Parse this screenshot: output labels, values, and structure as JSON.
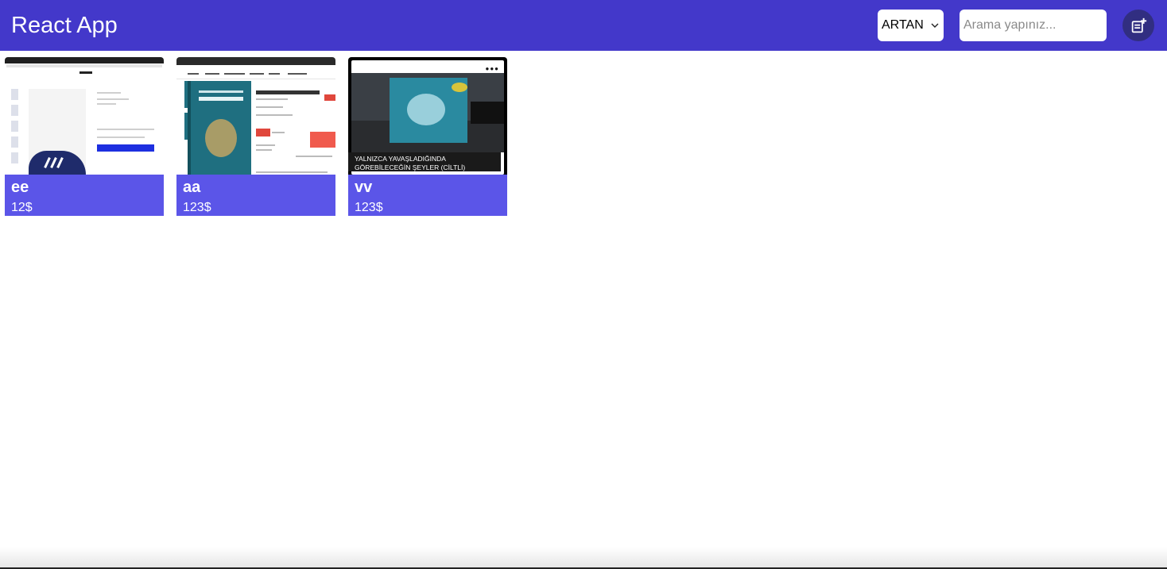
{
  "navbar": {
    "brand": "React App",
    "sort": {
      "selected": "ARTAN"
    },
    "search": {
      "placeholder": "Arama yapınız..."
    },
    "add_icon": "note-add-icon",
    "bg_color": "#4338ca"
  },
  "products": [
    {
      "title": "ee",
      "price": "12$",
      "thumb": "shoe-shop-screenshot"
    },
    {
      "title": "aa",
      "price": "123$",
      "thumb": "book-shop-screenshot"
    },
    {
      "title": "vv",
      "price": "123$",
      "thumb": "book-photo",
      "caption": "YALNIZCA YAVAŞLADIĞINDA GÖREBİLECEĞİN ŞEYLER (CİLTLİ)"
    }
  ],
  "card_color": "#5b55e8"
}
